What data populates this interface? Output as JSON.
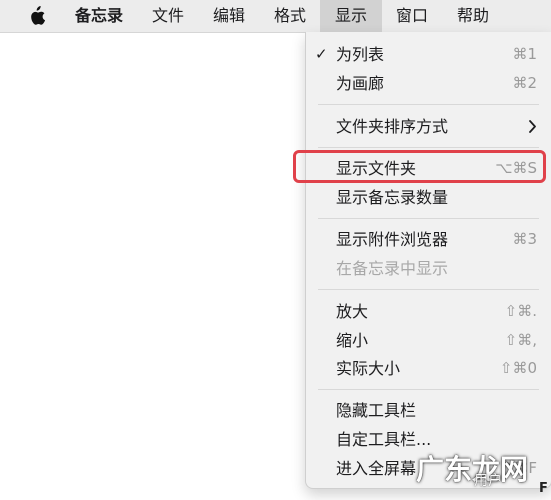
{
  "menubar": {
    "items": [
      "备忘录",
      "文件",
      "编辑",
      "格式",
      "显示",
      "窗口",
      "帮助"
    ],
    "active": "显示"
  },
  "menu": {
    "items": [
      {
        "label": "为列表",
        "shortcut": "⌘1",
        "checked": true,
        "enabled": true
      },
      {
        "label": "为画廊",
        "shortcut": "⌘2",
        "enabled": true
      },
      {
        "label": "文件夹排序方式",
        "submenu": true,
        "enabled": true
      },
      {
        "label": "显示文件夹",
        "shortcut": "⌥⌘S",
        "enabled": true,
        "highlighted": true
      },
      {
        "label": "显示备忘录数量",
        "enabled": true
      },
      {
        "label": "显示附件浏览器",
        "shortcut": "⌘3",
        "enabled": true
      },
      {
        "label": "在备忘录中显示",
        "enabled": false
      },
      {
        "label": "放大",
        "shortcut": "⇧⌘.",
        "enabled": true
      },
      {
        "label": "缩小",
        "shortcut": "⇧⌘,",
        "enabled": true
      },
      {
        "label": "实际大小",
        "shortcut": "⇧⌘0",
        "enabled": true
      },
      {
        "label": "隐藏工具栏",
        "enabled": true
      },
      {
        "label": "自定工具栏...",
        "enabled": true
      },
      {
        "label": "进入全屏幕",
        "shortcut": "^⌘F",
        "enabled": true
      }
    ],
    "check_mark": "✓"
  },
  "watermark": {
    "main": "广东龙网",
    "sub": "用户"
  },
  "edge_text": "F",
  "colors": {
    "highlight_border": "#e0414a",
    "menubar_bg": "#ececec",
    "menu_bg": "#f1f1f1"
  }
}
